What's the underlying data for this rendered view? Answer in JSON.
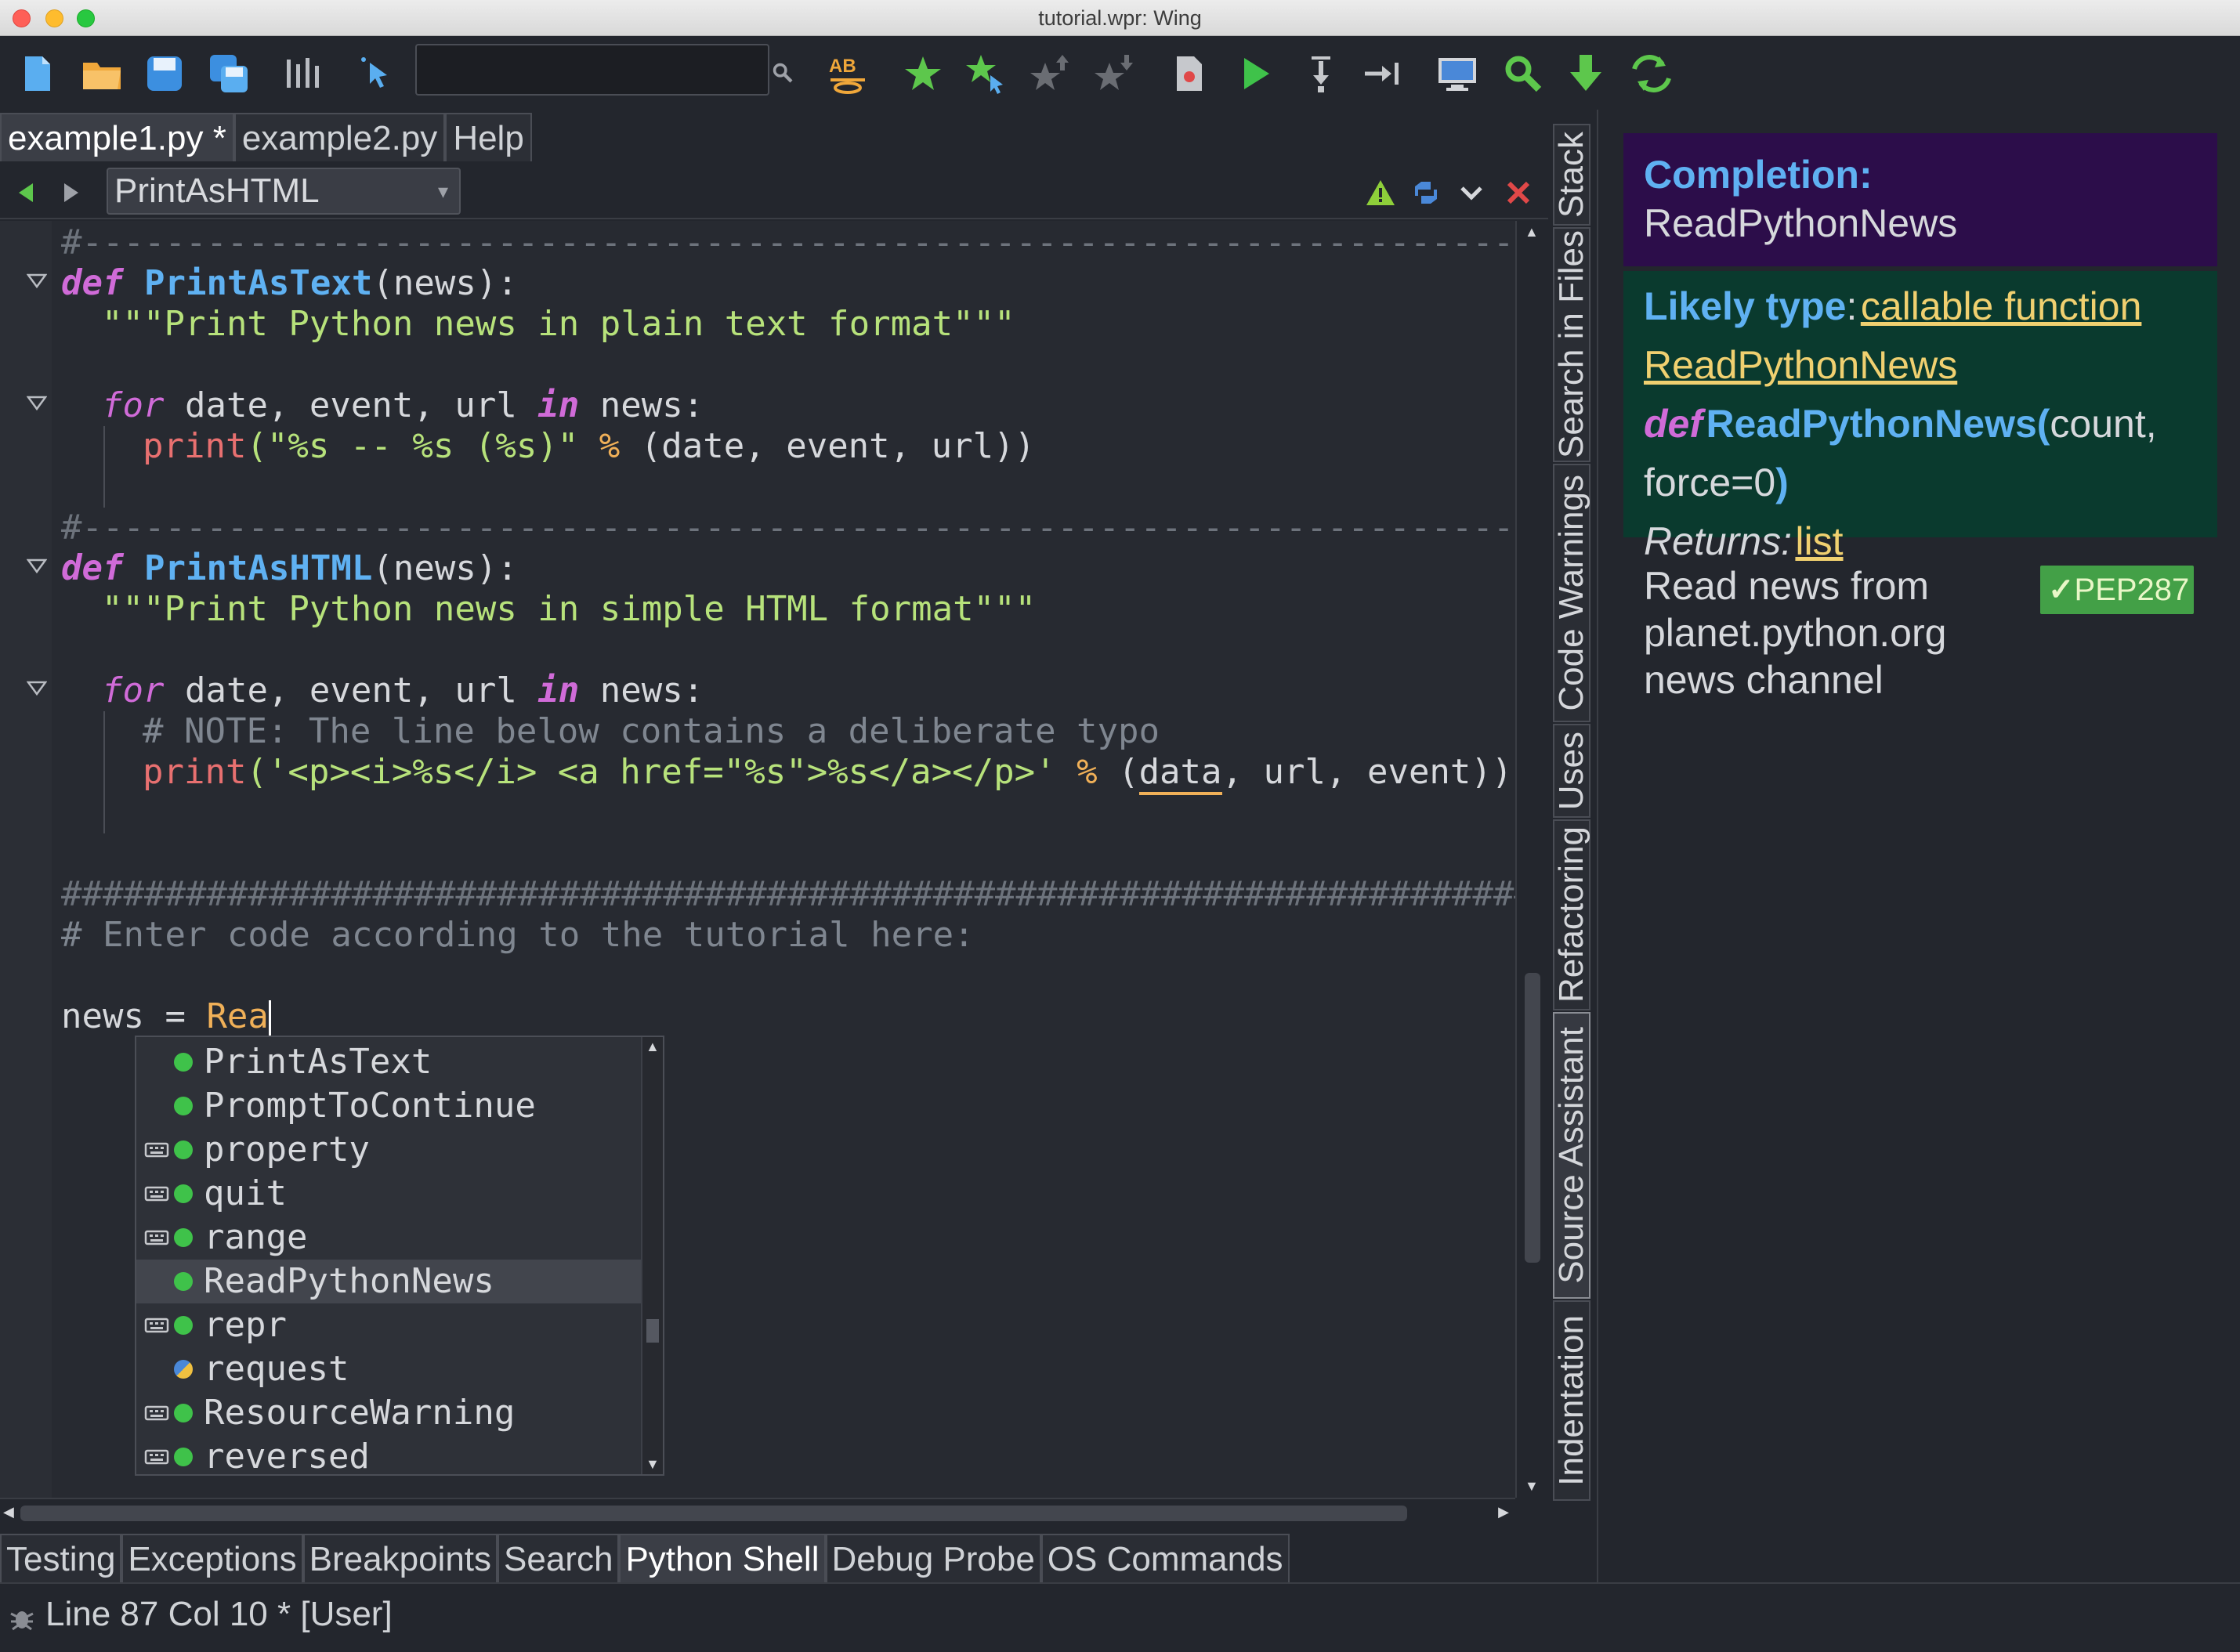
{
  "window": {
    "title": "tutorial.wpr: Wing"
  },
  "editor_tabs": [
    {
      "label": "example1.py *",
      "active": true
    },
    {
      "label": "example2.py",
      "active": false
    },
    {
      "label": "Help",
      "active": false
    }
  ],
  "editor_header": {
    "function_select": "PrintAsHTML"
  },
  "code": {
    "sep_line": "#---------------------------------------------------------------------------------------------------------",
    "def1_kw": "def",
    "def1_name": "PrintAsText",
    "def1_args": "(news):",
    "doc1": "\"\"\"Print Python news in plain text format\"\"\"",
    "for_kw": "for",
    "for_vars": " date, event, url ",
    "in_kw": "in",
    "for_tail": " news:",
    "print1_fn": "print",
    "print1_str": "(\"%s -- %s (%s)\"",
    "print1_op": " % ",
    "print1_args": "(date, event, url))",
    "def2_kw": "def",
    "def2_name": "PrintAsHTML",
    "def2_args": "(news):",
    "doc2": "\"\"\"Print Python news in simple HTML format\"\"\"",
    "note": "# NOTE: The line below contains a deliberate typo",
    "print2_fn": "print",
    "print2_str": "('<p><i>%s</i> <a href=\"%s\">%s</a></p>'",
    "print2_op": " % ",
    "print2_open": "(",
    "print2_typo": "data",
    "print2_rest": ", url, event))",
    "hash_line": "##############################################################################",
    "tutorial_comment": "# Enter code according to the tutorial here:",
    "news_assign": "news = ",
    "news_typed": "Rea"
  },
  "autocomplete": {
    "items": [
      {
        "label": "PrintAsText",
        "builtin": false,
        "icon": "function-icon"
      },
      {
        "label": "PromptToContinue",
        "builtin": false,
        "icon": "function-icon"
      },
      {
        "label": "property",
        "builtin": true,
        "icon": "function-icon"
      },
      {
        "label": "quit",
        "builtin": true,
        "icon": "function-icon"
      },
      {
        "label": "range",
        "builtin": true,
        "icon": "function-icon"
      },
      {
        "label": "ReadPythonNews",
        "builtin": false,
        "icon": "function-icon",
        "selected": true
      },
      {
        "label": "repr",
        "builtin": true,
        "icon": "function-icon"
      },
      {
        "label": "request",
        "builtin": false,
        "icon": "module-icon"
      },
      {
        "label": "ResourceWarning",
        "builtin": true,
        "icon": "function-icon"
      },
      {
        "label": "reversed",
        "builtin": true,
        "icon": "function-icon"
      }
    ]
  },
  "tool_tabs": [
    {
      "label": "Stack"
    },
    {
      "label": "Search in Files"
    },
    {
      "label": "Code Warnings"
    },
    {
      "label": "Uses"
    },
    {
      "label": "Refactoring"
    },
    {
      "label": "Source Assistant",
      "active": true
    },
    {
      "label": "Indentation"
    }
  ],
  "source_assistant": {
    "completion_heading": "Completion:",
    "completion_value": "ReadPythonNews",
    "likely_type_heading": "Likely type",
    "likely_type_colon": ":",
    "likely_type_link": "callable function",
    "likely_type_name": "ReadPythonNews",
    "def_kw": "def",
    "def_name": "ReadPythonNews(",
    "def_args": "count,",
    "def_args2": "force=0",
    "def_close": ")",
    "returns_label": "Returns:",
    "returns_link": "list",
    "doc_line1": "Read news from",
    "doc_line2": "planet.python.org",
    "doc_line3": "news channel",
    "pep_badge": "PEP287",
    "pep_check": "✓"
  },
  "bottom_tabs": [
    {
      "label": "Testing"
    },
    {
      "label": "Exceptions"
    },
    {
      "label": "Breakpoints"
    },
    {
      "label": "Search"
    },
    {
      "label": "Python Shell",
      "active": true
    },
    {
      "label": "Debug Probe"
    },
    {
      "label": "OS Commands"
    }
  ],
  "status": {
    "text": "Line 87 Col 10 * [User]"
  },
  "colors": {
    "background": "#23262d",
    "keyword": "#d06bd8",
    "function": "#5fb1f2",
    "string": "#b7e27b",
    "comment": "#7f8690",
    "completion_bg": "#2c0d4a",
    "type_bg": "#0a3a2e",
    "pep_badge": "#43a047"
  }
}
